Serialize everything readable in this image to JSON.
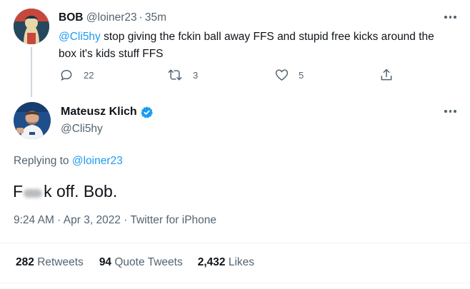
{
  "parent_tweet": {
    "display_name": "BOB",
    "handle": "@loiner23",
    "separator": "·",
    "time_ago": "35m",
    "mention": "@Cli5hy",
    "text_line1": " stop giving the fckin ball away FFS and stupid free kicks around the",
    "text_line2": "box it's kids stuff FFS",
    "reply_count": "22",
    "retweet_count": "3",
    "like_count": "5"
  },
  "main_tweet": {
    "display_name": "Mateusz Klich",
    "handle": "@Cli5hy",
    "verified": true,
    "replying_to_prefix": "Replying to",
    "replying_to_handle": "@loiner23",
    "text_start": "F",
    "text_end": "k off. Bob.",
    "timestamp": "9:24 AM · Apr 3, 2022 · Twitter for iPhone",
    "retweets_count": "282",
    "retweets_label": "Retweets",
    "quote_count": "94",
    "quote_label": "Quote Tweets",
    "likes_count": "2,432",
    "likes_label": "Likes"
  },
  "colors": {
    "accent": "#1d9bf0",
    "muted": "#536471",
    "text": "#0f1419",
    "divider": "#eff3f4"
  },
  "icons": [
    "more-icon",
    "reply-icon",
    "retweet-icon",
    "like-icon",
    "share-icon",
    "verified-badge-icon"
  ]
}
